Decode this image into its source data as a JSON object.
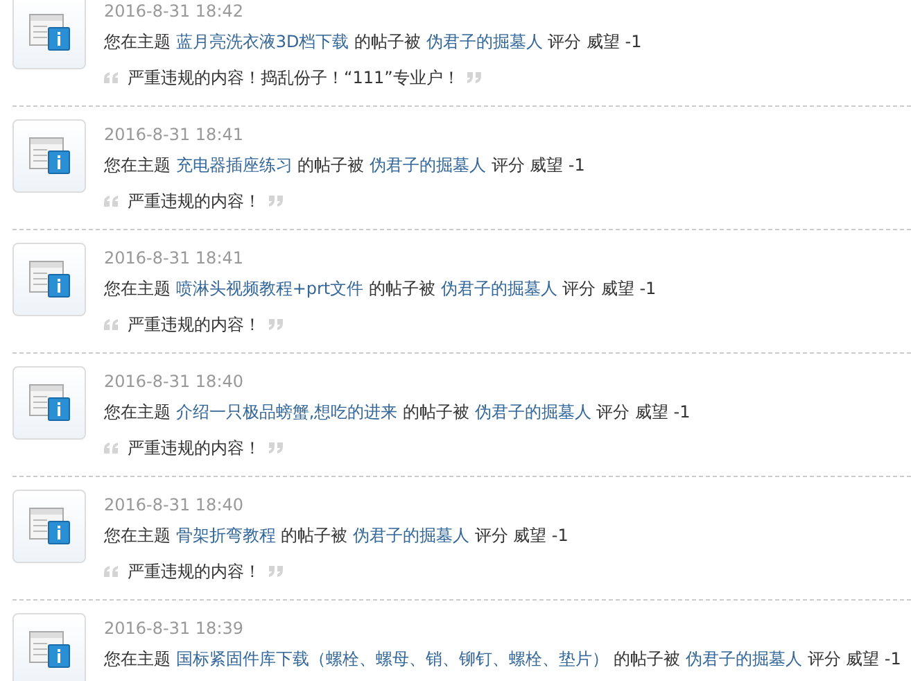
{
  "notices": [
    {
      "date": "2016-8-31 18:42",
      "prefix": "您在主题",
      "topic": "蓝月亮洗衣液3D档下载",
      "middle": "的帖子被",
      "user": "伪君子的掘墓人",
      "suffix": "评分 威望 -1",
      "reason": "严重违规的内容！捣乱份子！“111”专业户！"
    },
    {
      "date": "2016-8-31 18:41",
      "prefix": "您在主题",
      "topic": "充电器插座练习",
      "middle": "的帖子被",
      "user": "伪君子的掘墓人",
      "suffix": "评分 威望 -1",
      "reason": "严重违规的内容！"
    },
    {
      "date": "2016-8-31 18:41",
      "prefix": "您在主题",
      "topic": "喷淋头视频教程+prt文件",
      "middle": "的帖子被",
      "user": "伪君子的掘墓人",
      "suffix": "评分 威望 -1",
      "reason": "严重违规的内容！"
    },
    {
      "date": "2016-8-31 18:40",
      "prefix": "您在主题",
      "topic": "介绍一只极品螃蟹,想吃的进来",
      "middle": "的帖子被",
      "user": "伪君子的掘墓人",
      "suffix": "评分 威望 -1",
      "reason": "严重违规的内容！"
    },
    {
      "date": "2016-8-31 18:40",
      "prefix": "您在主题",
      "topic": "骨架折弯教程",
      "middle": "的帖子被",
      "user": "伪君子的掘墓人",
      "suffix": "评分 威望 -1",
      "reason": "严重违规的内容！"
    },
    {
      "date": "2016-8-31 18:39",
      "prefix": "您在主题",
      "topic": "国标紧固件库下载（螺栓、螺母、销、铆钉、螺栓、垫片）",
      "middle": "的帖子被",
      "user": "伪君子的掘墓人",
      "suffix": "评分 威望 -1"
    }
  ]
}
